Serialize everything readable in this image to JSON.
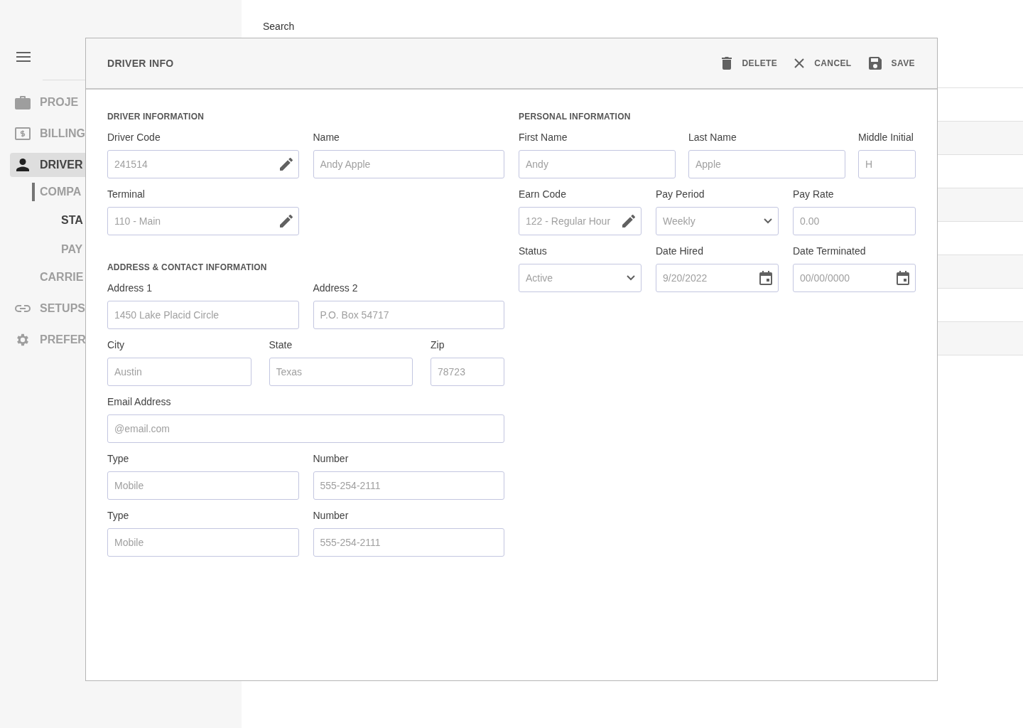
{
  "sidebar": {
    "items": [
      {
        "label": "PROJE",
        "selected": false
      },
      {
        "label": "BILLING",
        "selected": false
      },
      {
        "label": "DRIVER",
        "selected": true,
        "children": [
          {
            "label": "COMPA",
            "selected": false,
            "expanded": true,
            "children": [
              {
                "label": "STA",
                "selected": true
              },
              {
                "label": "PAY",
                "selected": false
              }
            ]
          },
          {
            "label": "CARRIE",
            "selected": false
          }
        ]
      },
      {
        "label": "SETUPS",
        "selected": false
      },
      {
        "label": "PREFER",
        "selected": false
      }
    ]
  },
  "background": {
    "search_label": "Search"
  },
  "modal": {
    "title": "DRIVER INFO",
    "actions": [
      {
        "label": "DELETE",
        "kind": "delete"
      },
      {
        "label": "CANCEL",
        "kind": "cancel"
      },
      {
        "label": "SAVE",
        "kind": "save"
      }
    ],
    "columns": [
      [
        {
          "title": "DRIVER INFORMATION",
          "rows": [
            [
              {
                "label": "Driver Code",
                "placeholder": "241514",
                "kind": "edit"
              },
              {
                "label": "Name",
                "placeholder": "Andy Apple",
                "kind": "text"
              }
            ],
            [
              {
                "label": "Terminal",
                "placeholder": "110 - Main",
                "kind": "edit"
              }
            ]
          ]
        },
        {
          "title": "ADDRESS & CONTACT INFORMATION",
          "rows": [
            [
              {
                "label": "Address 1",
                "placeholder": "1450 Lake Placid Circle",
                "kind": "text"
              },
              {
                "label": "Address 2",
                "placeholder": "P.O. Box 54717",
                "kind": "text"
              }
            ],
            [
              {
                "label": "City",
                "placeholder": "Austin",
                "kind": "text"
              },
              {
                "label": "State",
                "placeholder": "Texas",
                "kind": "text"
              },
              {
                "label": "Zip",
                "placeholder": "78723",
                "kind": "text"
              }
            ],
            [
              {
                "label": "Email Address",
                "placeholder": "@email.com",
                "kind": "text"
              }
            ],
            [
              {
                "label": "Type",
                "placeholder": "Mobile",
                "kind": "text"
              },
              {
                "label": "Number",
                "placeholder": "555-254-2111",
                "kind": "text"
              }
            ],
            [
              {
                "label": "Type",
                "placeholder": "Mobile",
                "kind": "text"
              },
              {
                "label": "Number",
                "placeholder": "555-254-2111",
                "kind": "text"
              }
            ]
          ]
        }
      ],
      [
        {
          "title": "PERSONAL INFORMATION",
          "rows": [
            [
              {
                "label": "First Name",
                "placeholder": "Andy",
                "kind": "text"
              },
              {
                "label": "Last Name",
                "placeholder": "Apple",
                "kind": "text"
              },
              {
                "label": "Middle Initial",
                "placeholder": "H",
                "kind": "text"
              }
            ],
            [
              {
                "label": "Earn Code",
                "placeholder": "122 - Regular Hour",
                "kind": "edit"
              },
              {
                "label": "Pay Period",
                "placeholder": "Weekly",
                "kind": "select"
              },
              {
                "label": "Pay Rate",
                "placeholder": "0.00",
                "kind": "text"
              }
            ],
            [
              {
                "label": "Status",
                "placeholder": "Active",
                "kind": "select"
              },
              {
                "label": "Date Hired",
                "placeholder": "9/20/2022",
                "kind": "date"
              },
              {
                "label": "Date Terminated",
                "placeholder": "00/00/0000",
                "kind": "date"
              }
            ]
          ]
        }
      ]
    ]
  }
}
